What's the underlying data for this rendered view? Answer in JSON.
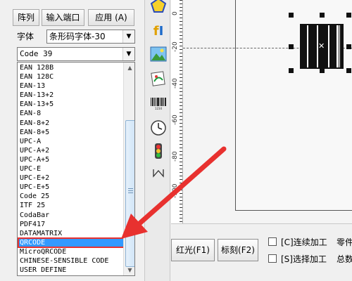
{
  "top_buttons": [
    "阵列",
    "输入端口",
    "应用 (A)"
  ],
  "font": {
    "label": "字体",
    "value": "条形码字体-30"
  },
  "barcode_type": {
    "value": "Code 39"
  },
  "barcode_list": [
    "EAN 128B",
    "EAN 128C",
    "EAN-13",
    "EAN-13+2",
    "EAN-13+5",
    "EAN-8",
    "EAN-8+2",
    "EAN-8+5",
    "UPC-A",
    "UPC-A+2",
    "UPC-A+5",
    "UPC-E",
    "UPC-E+2",
    "UPC-E+5",
    "Code 25",
    "ITF 25",
    "CodaBar",
    "PDF417",
    "DATAMATRIX",
    "QRCODE",
    "MicroQRCODE",
    "CHINESE-SENSIBLE CODE",
    "USER DEFINE"
  ],
  "selected_item": "QRCODE",
  "toolbar_icons": [
    "pentagon-icon",
    "text-tool-icon",
    "image-icon",
    "vector-import-icon",
    "barcode-icon",
    "clock-icon",
    "traffic-light-icon",
    "zigzag-icon"
  ],
  "ruler_labels": [
    "0",
    "-20",
    "-40",
    "-60",
    "-80",
    "-100"
  ],
  "bottom": {
    "red_light_button": "红光(F1)",
    "mark_button": "标刻(F2)",
    "continuous": "[C]连续加工",
    "select_process": "[S]选择加工",
    "part_count_label": "零件",
    "total_label": "总数"
  },
  "colors": {
    "selection": "#3399ff",
    "annotation_arrow": "#e8312f"
  }
}
